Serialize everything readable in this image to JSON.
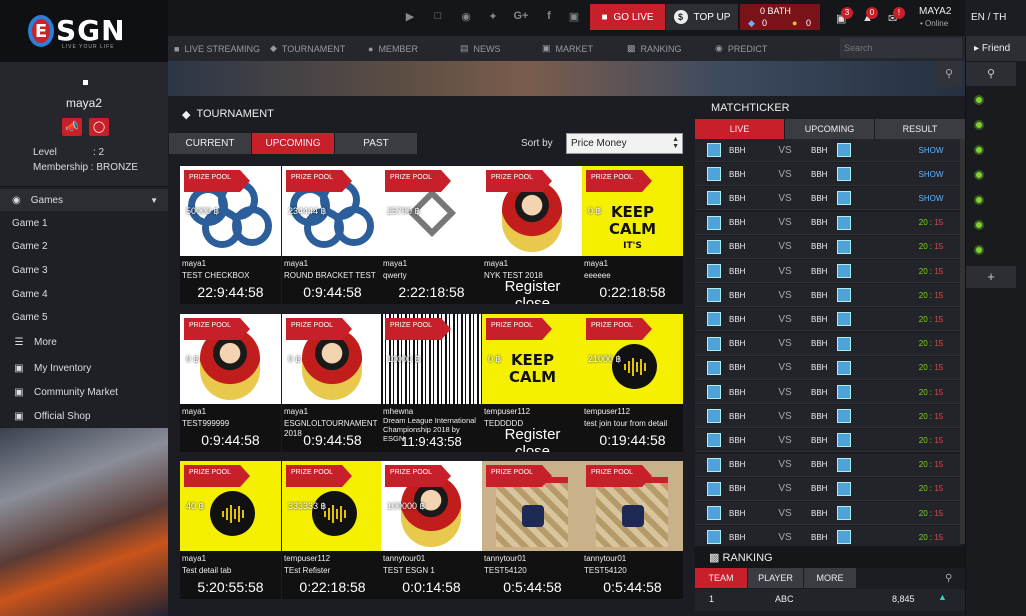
{
  "logo": {
    "text": "SGN",
    "letter": "E",
    "tagline": "LIVE YOUR LIFE"
  },
  "profile": {
    "username": "maya2",
    "level_label": "Level",
    "level_value": ": 2",
    "membership": "Membership : BRONZE"
  },
  "sidebar": {
    "games_label": "Games",
    "games": [
      "Game 1",
      "Game 2",
      "Game 3",
      "Game 4",
      "Game 5"
    ],
    "more": "More",
    "links": [
      "My Inventory",
      "Community Market",
      "Official Shop"
    ]
  },
  "topbar": {
    "go_live": "GO LIVE",
    "top_up": "TOP UP",
    "bath": "0 BATH",
    "coins_a": "0",
    "coins_b": "0",
    "badges": [
      "3",
      "0",
      "!"
    ],
    "user": "MAYA2",
    "status": "• Online",
    "lang": "EN / TH"
  },
  "nav": {
    "items": [
      "LIVE STREAMING",
      "TOURNAMENT",
      "MEMBER",
      "NEWS",
      "MARKET",
      "RANKING",
      "PREDICT"
    ],
    "search_placeholder": "Search"
  },
  "friend": {
    "label": "Friend",
    "plus": "+"
  },
  "tournament": {
    "title": "TOURNAMENT",
    "tabs": [
      "CURRENT",
      "UPCOMING",
      "PAST"
    ],
    "sort_label": "Sort by",
    "sort_value": "Price Money",
    "prize_label": "PRIZE POOL",
    "cards": [
      {
        "owner": "maya1",
        "name": "TEST CHECKBOX",
        "amount": "50000 ฿",
        "timer": "22:9:44:58",
        "img": "chain"
      },
      {
        "owner": "maya1",
        "name": "ROUND BRACKET TEST",
        "amount": "234444 ฿",
        "timer": "0:9:44:58",
        "img": "chain"
      },
      {
        "owner": "maya1",
        "name": "qwerty",
        "amount": "25790 ฿",
        "timer": "2:22:18:58",
        "img": "logo"
      },
      {
        "owner": "maya1",
        "name": "NYK TEST 2018",
        "amount": "",
        "timer": "",
        "register": "Register",
        "close": "close",
        "img": "avatar"
      },
      {
        "owner": "maya1",
        "name": "eeeeee",
        "amount": "0 ฿",
        "timer": "0:22:18:58",
        "img": "keepcalm",
        "calm": [
          "KEEP",
          "CALM",
          "IT'S"
        ]
      },
      {
        "owner": "maya1",
        "name": "TEST999999",
        "amount": "0 ฿",
        "timer": "0:9:44:58",
        "img": "avatar"
      },
      {
        "owner": "maya1",
        "name": "ESGNLOLTOURNAMENT 2018",
        "amount": "0 ฿",
        "timer": "0:9:44:58",
        "img": "avatar"
      },
      {
        "owner": "mhewna",
        "name": "Dream League International Championship 2018 by ESGN",
        "amount": "10000 ฿",
        "timer": "11:9:43:58",
        "img": "barcode"
      },
      {
        "owner": "tempuser112",
        "name": "TEDDDDD",
        "amount": "0 ฿",
        "timer": "",
        "register": "Register",
        "close": "close",
        "img": "keepcalm",
        "calm": [
          "KEEP",
          "CALM"
        ]
      },
      {
        "owner": "tempuser112",
        "name": "test join tour from detail",
        "amount": "21000 ฿",
        "timer": "0:19:44:58",
        "img": "audio"
      },
      {
        "owner": "maya1",
        "name": "Test detail tab",
        "amount": "40 ฿",
        "timer": "5:20:55:58",
        "img": "audio"
      },
      {
        "owner": "tempuser112",
        "name": "TEst Refister",
        "amount": "333333 ฿",
        "timer": "0:22:18:58",
        "img": "audio"
      },
      {
        "owner": "tannytour01",
        "name": "TEST ESGN 1",
        "amount": "100000 ฿",
        "timer": "0:0:14:58",
        "img": "avatar"
      },
      {
        "owner": "tannytour01",
        "name": "TEST54120",
        "amount": "",
        "timer": "0:5:44:58",
        "img": "bag"
      },
      {
        "owner": "tannytour01",
        "name": "TEST54120",
        "amount": "",
        "timer": "0:5:44:58",
        "img": "bag"
      }
    ]
  },
  "matchticker": {
    "title": "MATCHTICKER",
    "tabs": [
      "LIVE",
      "UPCOMING",
      "RESULT"
    ],
    "rows": [
      {
        "t1": "BBH",
        "vs": "VS",
        "t2": "BBH",
        "res": "SHOW"
      },
      {
        "t1": "BBH",
        "vs": "VS",
        "t2": "BBH",
        "res": "SHOW"
      },
      {
        "t1": "BBH",
        "vs": "VS",
        "t2": "BBH",
        "res": "SHOW"
      },
      {
        "t1": "BBH",
        "vs": "VS",
        "t2": "BBH",
        "s1": "20",
        "s2": "15"
      },
      {
        "t1": "BBH",
        "vs": "VS",
        "t2": "BBH",
        "s1": "20",
        "s2": "15"
      },
      {
        "t1": "BBH",
        "vs": "VS",
        "t2": "BBH",
        "s1": "20",
        "s2": "15"
      },
      {
        "t1": "BBH",
        "vs": "VS",
        "t2": "BBH",
        "s1": "20",
        "s2": "15"
      },
      {
        "t1": "BBH",
        "vs": "VS",
        "t2": "BBH",
        "s1": "20",
        "s2": "15"
      },
      {
        "t1": "BBH",
        "vs": "VS",
        "t2": "BBH",
        "s1": "20",
        "s2": "15"
      },
      {
        "t1": "BBH",
        "vs": "VS",
        "t2": "BBH",
        "s1": "20",
        "s2": "15"
      },
      {
        "t1": "BBH",
        "vs": "VS",
        "t2": "BBH",
        "s1": "20",
        "s2": "15"
      },
      {
        "t1": "BBH",
        "vs": "VS",
        "t2": "BBH",
        "s1": "20",
        "s2": "15"
      },
      {
        "t1": "BBH",
        "vs": "VS",
        "t2": "BBH",
        "s1": "20",
        "s2": "15"
      },
      {
        "t1": "BBH",
        "vs": "VS",
        "t2": "BBH",
        "s1": "20",
        "s2": "15"
      },
      {
        "t1": "BBH",
        "vs": "VS",
        "t2": "BBH",
        "s1": "20",
        "s2": "15"
      },
      {
        "t1": "BBH",
        "vs": "VS",
        "t2": "BBH",
        "s1": "20",
        "s2": "15"
      },
      {
        "t1": "BBH",
        "vs": "VS",
        "t2": "BBH",
        "s1": "20",
        "s2": "15"
      }
    ]
  },
  "ranking": {
    "title": "RANKING",
    "tabs": [
      "TEAM",
      "PLAYER",
      "MORE"
    ],
    "row": {
      "rank": "1",
      "name": "ABC",
      "score": "8,845"
    }
  },
  "colors": {
    "accent": "#c8202b",
    "score_win": "#7ed321",
    "score_lose": "#e84747",
    "show": "#5fb6ff"
  }
}
